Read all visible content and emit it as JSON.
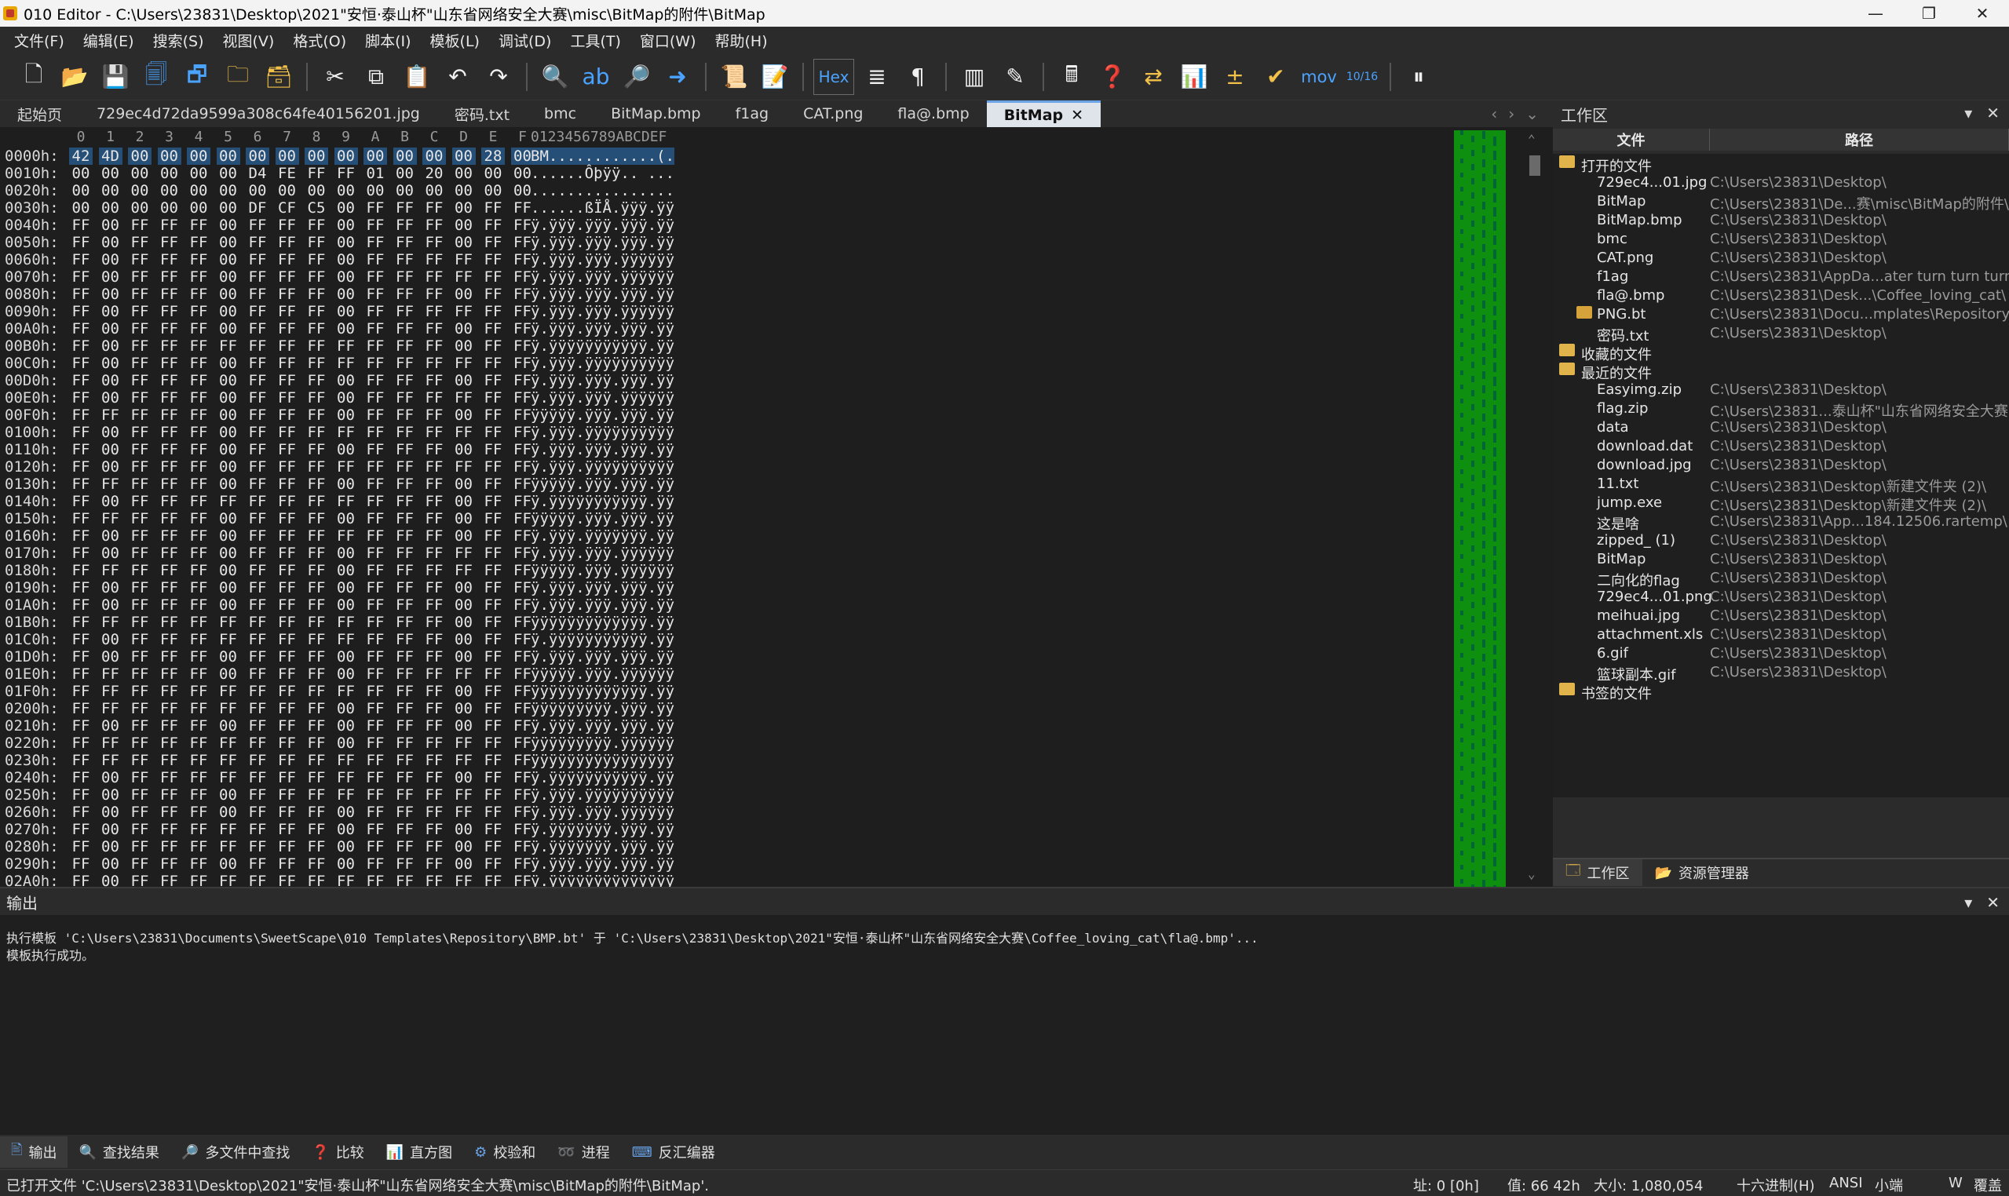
{
  "window": {
    "title": "010 Editor - C:\\Users\\23831\\Desktop\\2021\"安恒·泰山杯\"山东省网络安全大赛\\misc\\BitMap的附件\\BitMap",
    "minimize": "—",
    "maximize": "❐",
    "close": "✕"
  },
  "menu": [
    "文件(F)",
    "编辑(E)",
    "搜索(S)",
    "视图(V)",
    "格式(O)",
    "脚本(I)",
    "模板(L)",
    "调试(D)",
    "工具(T)",
    "窗口(W)",
    "帮助(H)"
  ],
  "toolbar": {
    "hex_label": "Hex",
    "mov_label": "mov",
    "base_label": "10/16"
  },
  "tabs": [
    "起始页",
    "729ec4d72da9599a308c64fe40156201.jpg",
    "密码.txt",
    "bmc",
    "BitMap.bmp",
    "f1ag",
    "CAT.png",
    "fla@.bmp",
    "BitMap"
  ],
  "active_tab": "BitMap",
  "hex": {
    "col_head": [
      "0",
      "1",
      "2",
      "3",
      "4",
      "5",
      "6",
      "7",
      "8",
      "9",
      "A",
      "B",
      "C",
      "D",
      "E",
      "F"
    ],
    "ascii_head": "0123456789ABCDEF",
    "rows": [
      {
        "o": "0000h:",
        "b": "42 4D 00 00 00 00 00 00 00 00 00 00 00 00 28 00",
        "a": "BM............(."
      },
      {
        "o": "0010h:",
        "b": "00 00 00 00 00 00 D4 FE FF FF 01 00 20 00 00 00",
        "a": "......Ôþÿÿ.. ..."
      },
      {
        "o": "0020h:",
        "b": "00 00 00 00 00 00 00 00 00 00 00 00 00 00 00 00",
        "a": "................"
      },
      {
        "o": "0030h:",
        "b": "00 00 00 00 00 00 DF CF C5 00 FF FF FF 00 FF FF",
        "a": "......ßÏÅ.ÿÿÿ.ÿÿ"
      },
      {
        "o": "0040h:",
        "b": "FF 00 FF FF FF 00 FF FF FF 00 FF FF FF 00 FF FF",
        "a": "ÿ.ÿÿÿ.ÿÿÿ.ÿÿÿ.ÿÿ"
      },
      {
        "o": "0050h:",
        "b": "FF 00 FF FF FF 00 FF FF FF 00 FF FF FF 00 FF FF",
        "a": "ÿ.ÿÿÿ.ÿÿÿ.ÿÿÿ.ÿÿ"
      },
      {
        "o": "0060h:",
        "b": "FF 00 FF FF FF 00 FF FF FF 00 FF FF FF FF FF FF",
        "a": "ÿ.ÿÿÿ.ÿÿÿ.ÿÿÿÿÿÿ"
      },
      {
        "o": "0070h:",
        "b": "FF 00 FF FF FF 00 FF FF FF 00 FF FF FF FF FF FF",
        "a": "ÿ.ÿÿÿ.ÿÿÿ.ÿÿÿÿÿÿ"
      },
      {
        "o": "0080h:",
        "b": "FF 00 FF FF FF 00 FF FF FF 00 FF FF FF 00 FF FF",
        "a": "ÿ.ÿÿÿ.ÿÿÿ.ÿÿÿ.ÿÿ"
      },
      {
        "o": "0090h:",
        "b": "FF 00 FF FF FF 00 FF FF FF 00 FF FF FF FF FF FF",
        "a": "ÿ.ÿÿÿ.ÿÿÿ.ÿÿÿÿÿÿ"
      },
      {
        "o": "00A0h:",
        "b": "FF 00 FF FF FF 00 FF FF FF 00 FF FF FF 00 FF FF",
        "a": "ÿ.ÿÿÿ.ÿÿÿ.ÿÿÿ.ÿÿ"
      },
      {
        "o": "00B0h:",
        "b": "FF 00 FF FF FF FF FF FF FF FF FF FF FF 00 FF FF",
        "a": "ÿ.ÿÿÿÿÿÿÿÿÿÿÿ.ÿÿ"
      },
      {
        "o": "00C0h:",
        "b": "FF 00 FF FF FF 00 FF FF FF FF FF FF FF FF FF FF",
        "a": "ÿ.ÿÿÿ.ÿÿÿÿÿÿÿÿÿÿ"
      },
      {
        "o": "00D0h:",
        "b": "FF 00 FF FF FF 00 FF FF FF 00 FF FF FF 00 FF FF",
        "a": "ÿ.ÿÿÿ.ÿÿÿ.ÿÿÿ.ÿÿ"
      },
      {
        "o": "00E0h:",
        "b": "FF 00 FF FF FF 00 FF FF FF 00 FF FF FF FF FF FF",
        "a": "ÿ.ÿÿÿ.ÿÿÿ.ÿÿÿÿÿÿ"
      },
      {
        "o": "00F0h:",
        "b": "FF FF FF FF FF 00 FF FF FF 00 FF FF FF 00 FF FF",
        "a": "ÿÿÿÿÿ.ÿÿÿ.ÿÿÿ.ÿÿ"
      },
      {
        "o": "0100h:",
        "b": "FF 00 FF FF FF 00 FF FF FF FF FF FF FF FF FF FF",
        "a": "ÿ.ÿÿÿ.ÿÿÿÿÿÿÿÿÿÿ"
      },
      {
        "o": "0110h:",
        "b": "FF 00 FF FF FF 00 FF FF FF 00 FF FF FF 00 FF FF",
        "a": "ÿ.ÿÿÿ.ÿÿÿ.ÿÿÿ.ÿÿ"
      },
      {
        "o": "0120h:",
        "b": "FF 00 FF FF FF 00 FF FF FF FF FF FF FF FF FF FF",
        "a": "ÿ.ÿÿÿ.ÿÿÿÿÿÿÿÿÿÿ"
      },
      {
        "o": "0130h:",
        "b": "FF FF FF FF FF 00 FF FF FF 00 FF FF FF 00 FF FF",
        "a": "ÿÿÿÿÿ.ÿÿÿ.ÿÿÿ.ÿÿ"
      },
      {
        "o": "0140h:",
        "b": "FF 00 FF FF FF FF FF FF FF FF FF FF FF 00 FF FF",
        "a": "ÿ.ÿÿÿÿÿÿÿÿÿÿÿ.ÿÿ"
      },
      {
        "o": "0150h:",
        "b": "FF FF FF FF FF 00 FF FF FF 00 FF FF FF 00 FF FF",
        "a": "ÿÿÿÿÿ.ÿÿÿ.ÿÿÿ.ÿÿ"
      },
      {
        "o": "0160h:",
        "b": "FF 00 FF FF FF 00 FF FF FF FF FF FF FF 00 FF FF",
        "a": "ÿ.ÿÿÿ.ÿÿÿÿÿÿÿ.ÿÿ"
      },
      {
        "o": "0170h:",
        "b": "FF 00 FF FF FF 00 FF FF FF 00 FF FF FF FF FF FF",
        "a": "ÿ.ÿÿÿ.ÿÿÿ.ÿÿÿÿÿÿ"
      },
      {
        "o": "0180h:",
        "b": "FF FF FF FF FF 00 FF FF FF 00 FF FF FF FF FF FF",
        "a": "ÿÿÿÿÿ.ÿÿÿ.ÿÿÿÿÿÿ"
      },
      {
        "o": "0190h:",
        "b": "FF 00 FF FF FF 00 FF FF FF 00 FF FF FF 00 FF FF",
        "a": "ÿ.ÿÿÿ.ÿÿÿ.ÿÿÿ.ÿÿ"
      },
      {
        "o": "01A0h:",
        "b": "FF 00 FF FF FF 00 FF FF FF 00 FF FF FF 00 FF FF",
        "a": "ÿ.ÿÿÿ.ÿÿÿ.ÿÿÿ.ÿÿ"
      },
      {
        "o": "01B0h:",
        "b": "FF FF FF FF FF FF FF FF FF FF FF FF FF 00 FF FF",
        "a": "ÿÿÿÿÿÿÿÿÿÿÿÿÿ.ÿÿ"
      },
      {
        "o": "01C0h:",
        "b": "FF 00 FF FF FF FF FF FF FF FF FF FF FF 00 FF FF",
        "a": "ÿ.ÿÿÿÿÿÿÿÿÿÿÿ.ÿÿ"
      },
      {
        "o": "01D0h:",
        "b": "FF 00 FF FF FF 00 FF FF FF 00 FF FF FF 00 FF FF",
        "a": "ÿ.ÿÿÿ.ÿÿÿ.ÿÿÿ.ÿÿ"
      },
      {
        "o": "01E0h:",
        "b": "FF FF FF FF FF 00 FF FF FF 00 FF FF FF FF FF FF",
        "a": "ÿÿÿÿÿ.ÿÿÿ.ÿÿÿÿÿÿ"
      },
      {
        "o": "01F0h:",
        "b": "FF FF FF FF FF FF FF FF FF FF FF FF FF 00 FF FF",
        "a": "ÿÿÿÿÿÿÿÿÿÿÿÿÿ.ÿÿ"
      },
      {
        "o": "0200h:",
        "b": "FF FF FF FF FF FF FF FF FF 00 FF FF FF 00 FF FF",
        "a": "ÿÿÿÿÿÿÿÿÿ.ÿÿÿ.ÿÿ"
      },
      {
        "o": "0210h:",
        "b": "FF 00 FF FF FF 00 FF FF FF 00 FF FF FF 00 FF FF",
        "a": "ÿ.ÿÿÿ.ÿÿÿ.ÿÿÿ.ÿÿ"
      },
      {
        "o": "0220h:",
        "b": "FF FF FF FF FF FF FF FF FF 00 FF FF FF FF FF FF",
        "a": "ÿÿÿÿÿÿÿÿÿ.ÿÿÿÿÿÿ"
      },
      {
        "o": "0230h:",
        "b": "FF FF FF FF FF FF FF FF FF FF FF FF FF FF FF FF",
        "a": "ÿÿÿÿÿÿÿÿÿÿÿÿÿÿÿÿ"
      },
      {
        "o": "0240h:",
        "b": "FF 00 FF FF FF FF FF FF FF FF FF FF FF 00 FF FF",
        "a": "ÿ.ÿÿÿÿÿÿÿÿÿÿÿ.ÿÿ"
      },
      {
        "o": "0250h:",
        "b": "FF 00 FF FF FF 00 FF FF FF FF FF FF FF FF FF FF",
        "a": "ÿ.ÿÿÿ.ÿÿÿÿÿÿÿÿÿÿ"
      },
      {
        "o": "0260h:",
        "b": "FF 00 FF FF FF 00 FF FF FF 00 FF FF FF FF FF FF",
        "a": "ÿ.ÿÿÿ.ÿÿÿ.ÿÿÿÿÿÿ"
      },
      {
        "o": "0270h:",
        "b": "FF 00 FF FF FF FF FF FF FF 00 FF FF FF 00 FF FF",
        "a": "ÿ.ÿÿÿÿÿÿÿ.ÿÿÿ.ÿÿ"
      },
      {
        "o": "0280h:",
        "b": "FF 00 FF FF FF FF FF FF FF 00 FF FF FF 00 FF FF",
        "a": "ÿ.ÿÿÿÿÿÿÿ.ÿÿÿ.ÿÿ"
      },
      {
        "o": "0290h:",
        "b": "FF 00 FF FF FF 00 FF FF FF 00 FF FF FF 00 FF FF",
        "a": "ÿ.ÿÿÿ.ÿÿÿ.ÿÿÿ.ÿÿ"
      },
      {
        "o": "02A0h:",
        "b": "FF 00 FF FF FF FF FF FF FF FF FF FF FF FF FF FF",
        "a": "ÿ.ÿÿÿÿÿÿÿÿÿÿÿÿÿÿ"
      }
    ]
  },
  "workspace": {
    "title": "工作区",
    "col_file": "文件",
    "col_path": "路径",
    "items": [
      {
        "kind": "group",
        "name": "打开的文件",
        "path": ""
      },
      {
        "kind": "file",
        "name": "729ec4...01.jpg",
        "path": "C:\\Users\\23831\\Desktop\\"
      },
      {
        "kind": "file",
        "name": "BitMap",
        "path": "C:\\Users\\23831\\De...赛\\misc\\BitMap的附件\\"
      },
      {
        "kind": "file",
        "name": "BitMap.bmp",
        "path": "C:\\Users\\23831\\Desktop\\"
      },
      {
        "kind": "file",
        "name": "bmc",
        "path": "C:\\Users\\23831\\Desktop\\"
      },
      {
        "kind": "file",
        "name": "CAT.png",
        "path": "C:\\Users\\23831\\Desktop\\"
      },
      {
        "kind": "file",
        "name": "f1ag",
        "path": "C:\\Users\\23831\\AppDa...ater turn turn turn\\"
      },
      {
        "kind": "file",
        "name": "fla@.bmp",
        "path": "C:\\Users\\23831\\Desk...\\Coffee_loving_cat\\"
      },
      {
        "kind": "template",
        "name": "PNG.bt",
        "path": "C:\\Users\\23831\\Docu...mplates\\Repository\\"
      },
      {
        "kind": "file",
        "name": "密码.txt",
        "path": "C:\\Users\\23831\\Desktop\\"
      },
      {
        "kind": "group",
        "name": "收藏的文件",
        "path": ""
      },
      {
        "kind": "group",
        "name": "最近的文件",
        "path": ""
      },
      {
        "kind": "file",
        "name": "Easyimg.zip",
        "path": "C:\\Users\\23831\\Desktop\\"
      },
      {
        "kind": "file",
        "name": "flag.zip",
        "path": "C:\\Users\\23831...泰山杯\"山东省网络安全大赛"
      },
      {
        "kind": "file",
        "name": "data",
        "path": "C:\\Users\\23831\\Desktop\\"
      },
      {
        "kind": "file",
        "name": "download.dat",
        "path": "C:\\Users\\23831\\Desktop\\"
      },
      {
        "kind": "file",
        "name": "download.jpg",
        "path": "C:\\Users\\23831\\Desktop\\"
      },
      {
        "kind": "file",
        "name": "11.txt",
        "path": "C:\\Users\\23831\\Desktop\\新建文件夹 (2)\\"
      },
      {
        "kind": "file",
        "name": "jump.exe",
        "path": "C:\\Users\\23831\\Desktop\\新建文件夹 (2)\\"
      },
      {
        "kind": "file",
        "name": "这是啥",
        "path": "C:\\Users\\23831\\App...184.12506.rartemp\\"
      },
      {
        "kind": "file",
        "name": "zipped_ (1)",
        "path": "C:\\Users\\23831\\Desktop\\"
      },
      {
        "kind": "file",
        "name": "BitMap",
        "path": "C:\\Users\\23831\\Desktop\\"
      },
      {
        "kind": "file",
        "name": "二向化的flag",
        "path": "C:\\Users\\23831\\Desktop\\"
      },
      {
        "kind": "file",
        "name": "729ec4...01.png",
        "path": "C:\\Users\\23831\\Desktop\\"
      },
      {
        "kind": "file",
        "name": "meihuai.jpg",
        "path": "C:\\Users\\23831\\Desktop\\"
      },
      {
        "kind": "file",
        "name": "attachment.xls",
        "path": "C:\\Users\\23831\\Desktop\\"
      },
      {
        "kind": "file",
        "name": "6.gif",
        "path": "C:\\Users\\23831\\Desktop\\"
      },
      {
        "kind": "file",
        "name": "篮球副本.gif",
        "path": "C:\\Users\\23831\\Desktop\\"
      },
      {
        "kind": "group",
        "name": "书签的文件",
        "path": ""
      }
    ],
    "bottom_tabs": [
      "工作区",
      "资源管理器"
    ]
  },
  "output": {
    "title": "输出",
    "lines": [
      "执行模板 'C:\\Users\\23831\\Documents\\SweetScape\\010 Templates\\Repository\\BMP.bt' 于 'C:\\Users\\23831\\Desktop\\2021\"安恒·泰山杯\"山东省网络安全大赛\\Coffee_loving_cat\\fla@.bmp'...",
      "模板执行成功。"
    ]
  },
  "bottom_tabs": [
    "输出",
    "查找结果",
    "多文件中查找",
    "比较",
    "直方图",
    "校验和",
    "进程",
    "反汇编器"
  ],
  "status": {
    "message": "已打开文件 'C:\\Users\\23831\\Desktop\\2021\"安恒·泰山杯\"山东省网络安全大赛\\misc\\BitMap的附件\\BitMap'.",
    "address": "址: 0 [0h]",
    "value": "值: 66 42h",
    "size": "大小: 1,080,054",
    "mode": "十六进制(H)",
    "encoding": "ANSI",
    "endian": "小端",
    "width": "W",
    "overwrite": "覆盖"
  }
}
